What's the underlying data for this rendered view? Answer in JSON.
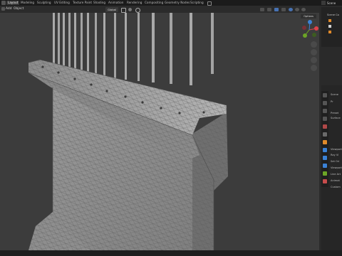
{
  "workspaces": [
    "Layout",
    "Modeling",
    "Sculpting",
    "UV Editing",
    "Texture Paint",
    "Shading",
    "Animation",
    "Rendering",
    "Compositing",
    "Geometry Nodes",
    "Scripting"
  ],
  "header_menu": [
    "Add",
    "Object"
  ],
  "view_mode": "Global",
  "options_label": "Options",
  "scene_label": "Scene",
  "outliner": {
    "scene_collection_label": "Scene Co"
  },
  "props_rows": [
    "Scene",
    "Pr",
    "Preset",
    "Surface",
    "Viewport",
    "Ray Vi",
    "Set Ori",
    "Viewport",
    "Line Art",
    "Animat",
    "Custom"
  ],
  "colors": {
    "accent": "#4772b3",
    "axis_x": "#e0424a",
    "axis_y": "#6ca526",
    "axis_z": "#3b82d6"
  }
}
